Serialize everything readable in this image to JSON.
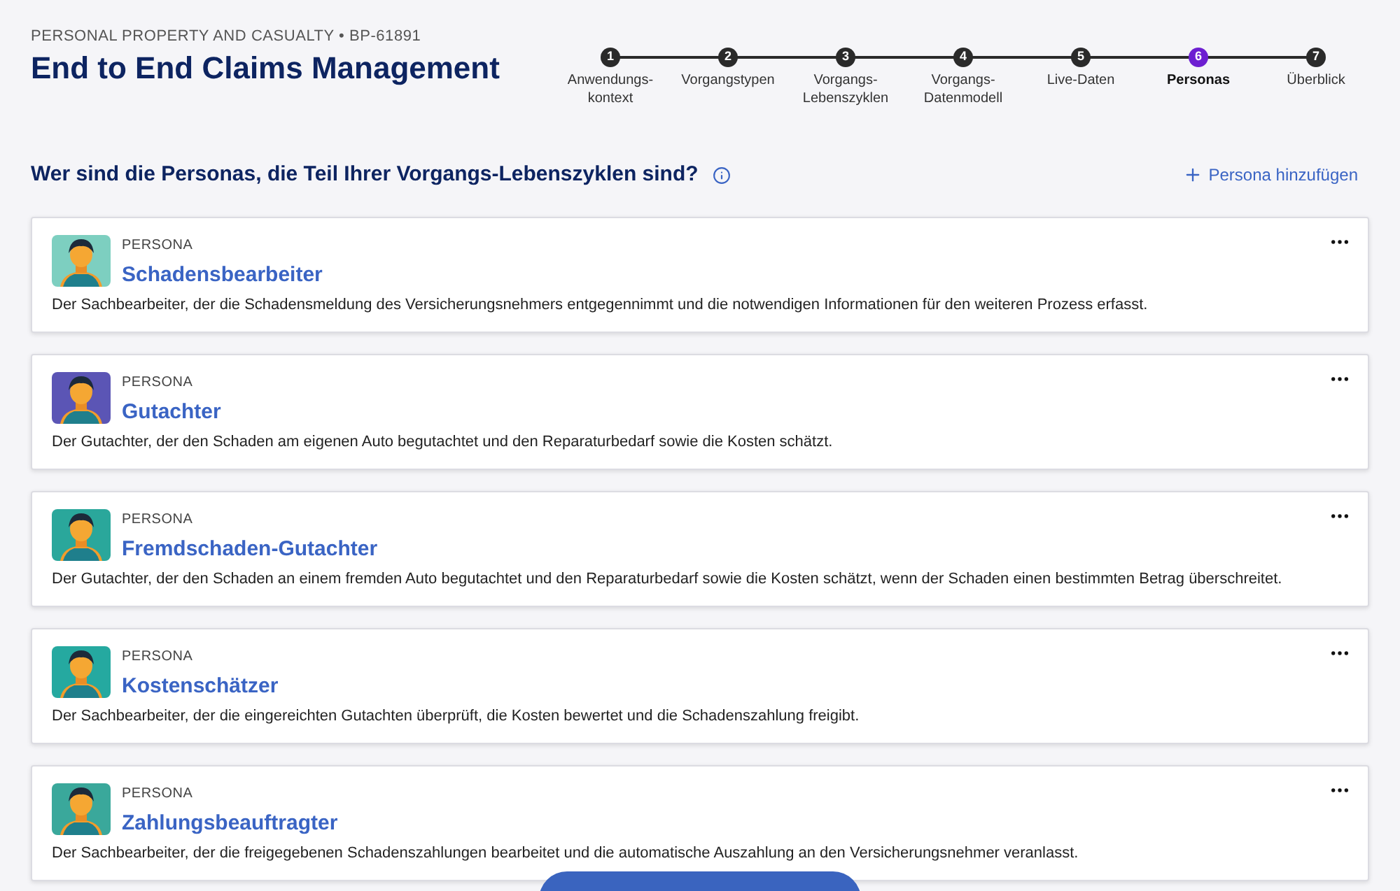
{
  "header": {
    "breadcrumb": "PERSONAL PROPERTY AND CASUALTY • BP-61891",
    "title": "End to End Claims Management"
  },
  "steps": [
    {
      "number": "1",
      "label": "Anwendungs-\nkontext",
      "selected": false
    },
    {
      "number": "2",
      "label": "Vorgangstypen",
      "selected": false
    },
    {
      "number": "3",
      "label": "Vorgangs-\nLebenszyklen",
      "selected": false
    },
    {
      "number": "4",
      "label": "Vorgangs-\nDatenmodell",
      "selected": false
    },
    {
      "number": "5",
      "label": "Live-Daten",
      "selected": false
    },
    {
      "number": "6",
      "label": "Personas",
      "selected": true
    },
    {
      "number": "7",
      "label": "Überblick",
      "selected": false
    }
  ],
  "section": {
    "heading": "Wer sind die Personas, die Teil Ihrer Vorgangs-Lebenszyklen sind?",
    "add_button": "Persona hinzufügen"
  },
  "personas": [
    {
      "tag": "PERSONA",
      "name": "Schadensbearbeiter",
      "description": "Der Sachbearbeiter, der die Schadensmeldung des Versicherungsnehmers entgegennimmt und die notwendigen Informationen für den weiteren Prozess erfasst.",
      "color": "#7dcfc0"
    },
    {
      "tag": "PERSONA",
      "name": "Gutachter",
      "description": "Der Gutachter, der den Schaden am eigenen Auto begutachtet und den Reparaturbedarf sowie die Kosten schätzt.",
      "color": "#5b55b5"
    },
    {
      "tag": "PERSONA",
      "name": "Fremdschaden-Gutachter",
      "description": "Der Gutachter, der den Schaden an einem fremden Auto begutachtet und den Reparaturbedarf sowie die Kosten schätzt, wenn der Schaden einen bestimmten Betrag überschreitet.",
      "color": "#2aa79b"
    },
    {
      "tag": "PERSONA",
      "name": "Kostenschätzer",
      "description": "Der Sachbearbeiter, der die eingereichten Gutachten überprüft, die Kosten bewertet und die Schadenszahlung freigibt.",
      "color": "#25a9a0"
    },
    {
      "tag": "PERSONA",
      "name": "Zahlungsbeauftragter",
      "description": "Der Sachbearbeiter, der die freigegebenen Schadenszahlungen bearbeitet und die automatische Auszahlung an den Versicherungsnehmer veranlasst.",
      "color": "#3aa89b"
    }
  ]
}
